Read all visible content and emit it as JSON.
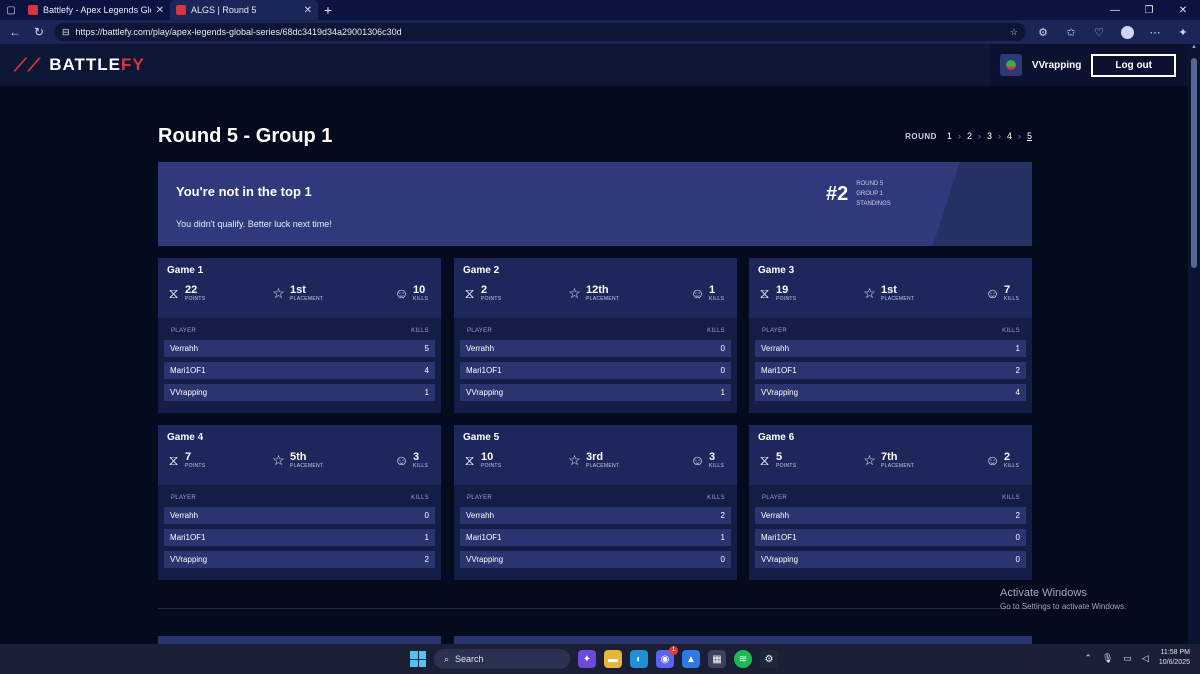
{
  "browser": {
    "tabs": [
      {
        "title": "Battlefy - Apex Legends Global Se",
        "active": false
      },
      {
        "title": "ALGS | Round 5",
        "active": true
      }
    ],
    "url": "https://battlefy.com/play/apex-legends-global-series/68dc3419d34a29001306c30d"
  },
  "header": {
    "logo_left": "BATTLE",
    "logo_right": "FY",
    "username": "VVrapping",
    "logout_label": "Log out"
  },
  "page": {
    "title": "Round 5 - Group 1",
    "round_label": "ROUND",
    "rounds": [
      "1",
      "2",
      "3",
      "4",
      "5"
    ],
    "current_round": "5"
  },
  "banner": {
    "heading": "You're not in the top 1",
    "message": "You didn't qualify. Better luck next time!",
    "rank": "#2",
    "meta": [
      "ROUND 5",
      "GROUP 1",
      "STANDINGS"
    ]
  },
  "labels": {
    "points": "POINTS",
    "placement": "PLACEMENT",
    "kills": "KILLS",
    "player_col": "PLAYER",
    "kills_col": "KILLS"
  },
  "games": [
    {
      "title": "Game 1",
      "points": "22",
      "placement": "1st",
      "kills": "10",
      "players": [
        {
          "name": "Verrahh",
          "kills": "5"
        },
        {
          "name": "Mari1OF1",
          "kills": "4"
        },
        {
          "name": "VVrapping",
          "kills": "1"
        }
      ]
    },
    {
      "title": "Game 2",
      "points": "2",
      "placement": "12th",
      "kills": "1",
      "players": [
        {
          "name": "Verrahh",
          "kills": "0"
        },
        {
          "name": "Mari1OF1",
          "kills": "0"
        },
        {
          "name": "VVrapping",
          "kills": "1"
        }
      ]
    },
    {
      "title": "Game 3",
      "points": "19",
      "placement": "1st",
      "kills": "7",
      "players": [
        {
          "name": "Verrahh",
          "kills": "1"
        },
        {
          "name": "Mari1OF1",
          "kills": "2"
        },
        {
          "name": "VVrapping",
          "kills": "4"
        }
      ]
    },
    {
      "title": "Game 4",
      "points": "7",
      "placement": "5th",
      "kills": "3",
      "players": [
        {
          "name": "Verrahh",
          "kills": "0"
        },
        {
          "name": "Mari1OF1",
          "kills": "1"
        },
        {
          "name": "VVrapping",
          "kills": "2"
        }
      ]
    },
    {
      "title": "Game 5",
      "points": "10",
      "placement": "3rd",
      "kills": "3",
      "players": [
        {
          "name": "Verrahh",
          "kills": "2"
        },
        {
          "name": "Mari1OF1",
          "kills": "1"
        },
        {
          "name": "VVrapping",
          "kills": "0"
        }
      ]
    },
    {
      "title": "Game 6",
      "points": "5",
      "placement": "7th",
      "kills": "2",
      "players": [
        {
          "name": "Verrahh",
          "kills": "2"
        },
        {
          "name": "Mari1OF1",
          "kills": "0"
        },
        {
          "name": "VVrapping",
          "kills": "0"
        }
      ]
    }
  ],
  "watermark": {
    "line1": "Activate Windows",
    "line2": "Go to Settings to activate Windows."
  },
  "taskbar": {
    "search_label": "Search",
    "time": "11:58 PM",
    "date": "10/6/2025",
    "discord_badge": "1"
  },
  "colors": {
    "background": "#050b1f",
    "card": "#1d275c",
    "banner": "#2f3a7c",
    "brand_red": "#d8353f"
  }
}
